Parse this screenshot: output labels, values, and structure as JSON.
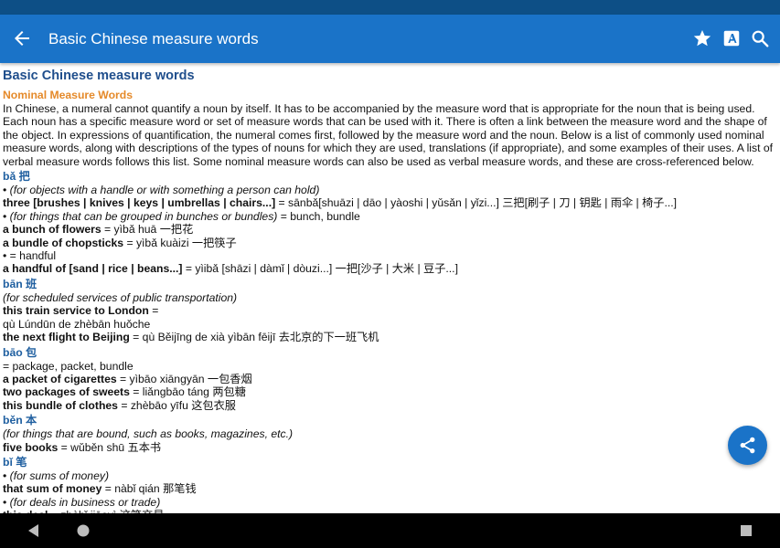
{
  "app": {
    "title": "Basic Chinese measure words"
  },
  "article": {
    "title": "Basic Chinese measure words",
    "section": "Nominal Measure Words",
    "intro": "In Chinese, a numeral cannot quantify a noun by itself. It has to be accompanied by the measure word that is appropriate for the noun that is being used. Each noun has a specific measure word or set of measure words that can be used with it. There is often a link between the measure word and the shape of the object. In expressions of quantification, the numeral comes first, followed by the measure word and the noun. Below is a list of commonly used nominal measure words, along with descriptions of the types of nouns for which they are used, translations (if appropriate), and some examples of their uses. A list of verbal measure words follows this list. Some nominal measure words can also be used as verbal measure words, and these are cross-referenced below."
  },
  "entries": [
    {
      "headword": "bǎ 把",
      "lines": [
        {
          "b": "",
          "i": "(for objects with a handle or with something a person can hold)",
          "t": "",
          "bullet": "• "
        },
        {
          "b": "three [brushes | knives | keys | umbrellas | chairs...]",
          "i": "",
          "t": " = sānbǎ[shuāzi | dāo | yàoshi | yǔsǎn | yǐzi...] 三把[刷子 | 刀 | 钥匙 | 雨伞 | 椅子...]",
          "bullet": ""
        },
        {
          "b": "",
          "i": "(for things that can be grouped in bunches or bundles)",
          "t": " = bunch, bundle",
          "bullet": "• "
        },
        {
          "b": "a bunch of flowers",
          "i": "",
          "t": " = yìbǎ huā 一把花",
          "bullet": ""
        },
        {
          "b": "a bundle of chopsticks",
          "i": "",
          "t": " = yìbǎ kuàizi 一把筷子",
          "bullet": ""
        },
        {
          "b": "",
          "i": "",
          "t": "= handful",
          "bullet": "• "
        },
        {
          "b": "a handful of [sand | rice | beans...]",
          "i": "",
          "t": " = yìibǎ [shāzi | dàmǐ | dòuzi...] 一把[沙子 | 大米 | 豆子...]",
          "bullet": ""
        }
      ]
    },
    {
      "headword": "bān 班",
      "lines": [
        {
          "b": "",
          "i": "(for scheduled services of public transportation)",
          "t": "",
          "bullet": ""
        },
        {
          "b": "this train service to London",
          "i": "",
          "t": " =",
          "bullet": ""
        },
        {
          "b": "",
          "i": "",
          "t": "qù Lúndūn de zhèbān huǒche",
          "bullet": ""
        },
        {
          "b": "the next flight to Beijing",
          "i": "",
          "t": " = qù Běijīng de xià yìbān fēijī 去北京的下一班飞机",
          "bullet": ""
        }
      ]
    },
    {
      "headword": "bāo 包",
      "lines": [
        {
          "b": "",
          "i": "",
          "t": "= package, packet, bundle",
          "bullet": ""
        },
        {
          "b": "a packet of cigarettes",
          "i": "",
          "t": " = yìbāo xiāngyān 一包香烟",
          "bullet": ""
        },
        {
          "b": "two packages of sweets",
          "i": "",
          "t": " = liǎngbāo táng 两包糖",
          "bullet": ""
        },
        {
          "b": "this bundle of clothes",
          "i": "",
          "t": " = zhèbāo yīfu 这包衣服",
          "bullet": ""
        }
      ]
    },
    {
      "headword": "běn 本",
      "lines": [
        {
          "b": "",
          "i": "(for things that are bound, such as books, magazines, etc.)",
          "t": "",
          "bullet": ""
        },
        {
          "b": "five books",
          "i": "",
          "t": " = wǔběn shū 五本书",
          "bullet": ""
        }
      ]
    },
    {
      "headword": "bǐ 笔",
      "lines": [
        {
          "b": "",
          "i": "(for sums of money)",
          "t": "",
          "bullet": "• "
        },
        {
          "b": "that sum of money",
          "i": "",
          "t": " = nàbǐ qián 那笔钱",
          "bullet": ""
        },
        {
          "b": "",
          "i": "(for deals in business or trade)",
          "t": "",
          "bullet": "• "
        },
        {
          "b": "this deal",
          "i": "",
          "t": " = zhèbǐ jiāoyì 这笔交易",
          "bullet": ""
        }
      ]
    }
  ],
  "icons": {
    "back": "arrow-left-icon",
    "favorite": "star-icon",
    "font_size": "text-format-icon",
    "search": "search-icon",
    "share": "share-icon",
    "nav_back": "triangle-back-icon",
    "nav_home": "circle-home-icon",
    "nav_recents": "square-recents-icon"
  },
  "colors": {
    "status_bar": "#0d4f86",
    "app_bar": "#1a73c8",
    "heading": "#1f4e8c",
    "section": "#e58a2a",
    "headword": "#1f5fa0"
  }
}
